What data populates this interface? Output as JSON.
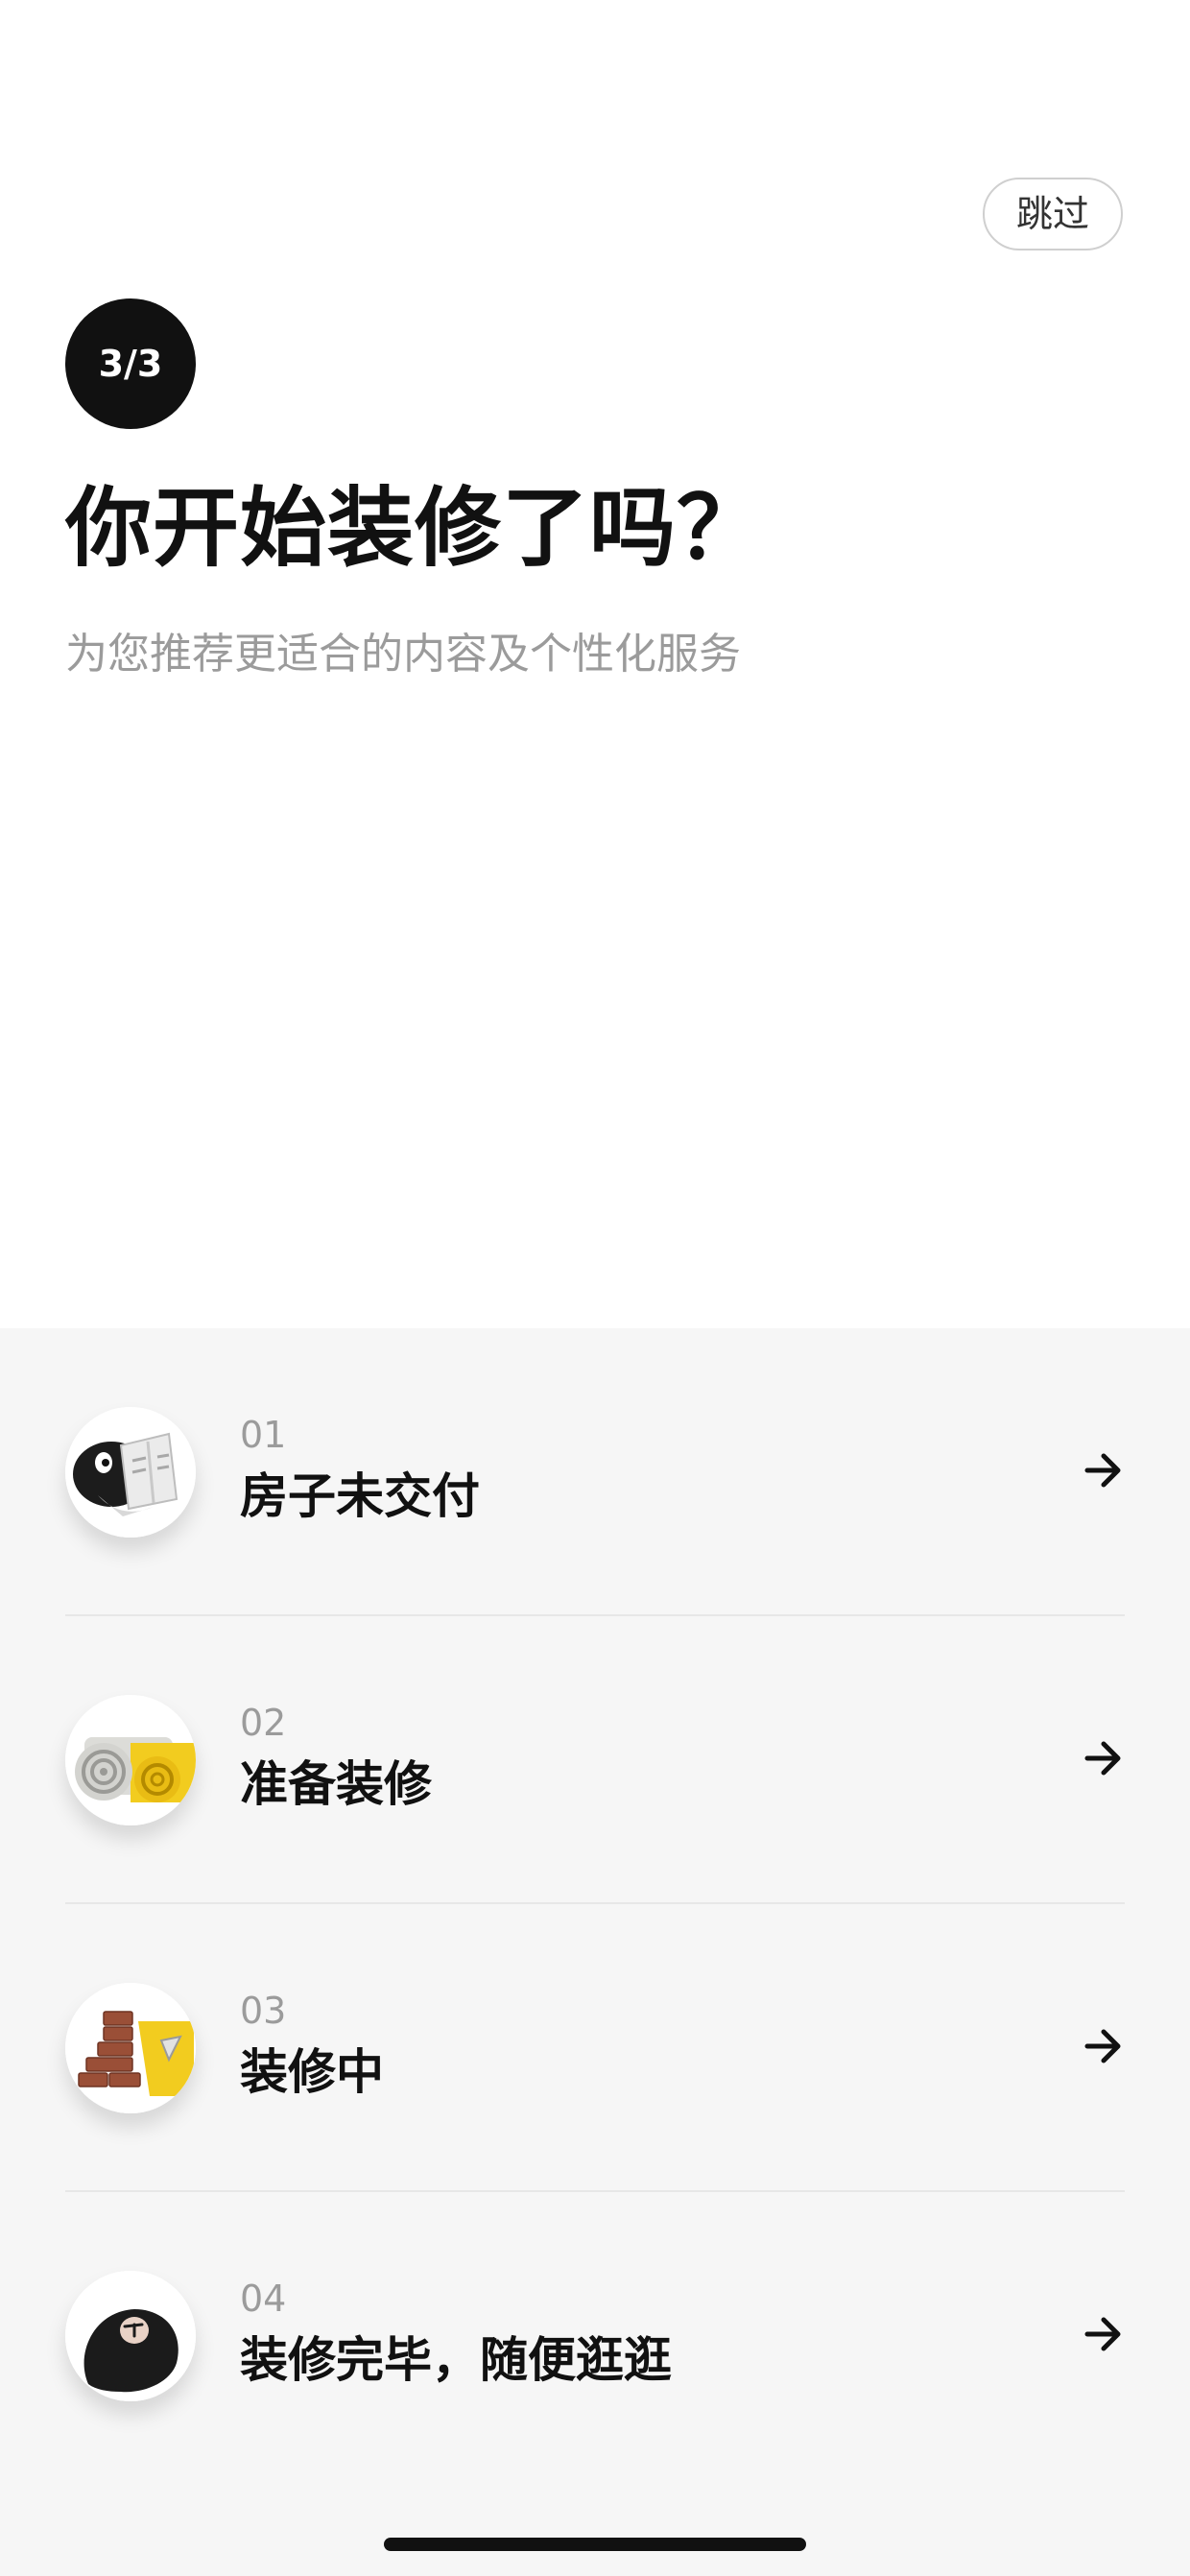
{
  "header": {
    "skip_label": "跳过",
    "step": "3/3",
    "title": "你开始装修了吗？",
    "subtitle": "为您推荐更适合的内容及个性化服务"
  },
  "options": [
    {
      "number": "01",
      "label": "房子未交付",
      "icon": "bird-reading-icon"
    },
    {
      "number": "02",
      "label": "准备装修",
      "icon": "wallpaper-roll-icon"
    },
    {
      "number": "03",
      "label": "装修中",
      "icon": "brick-wall-icon"
    },
    {
      "number": "04",
      "label": "装修完毕，随便逛逛",
      "icon": "black-bird-icon"
    }
  ],
  "colors": {
    "accent": "#111111",
    "subtle_text": "#9b9b9b",
    "panel_background": "#f6f6f6",
    "wallpaper_yellow": "#f2cc1f",
    "brick": "#9a4f37"
  }
}
